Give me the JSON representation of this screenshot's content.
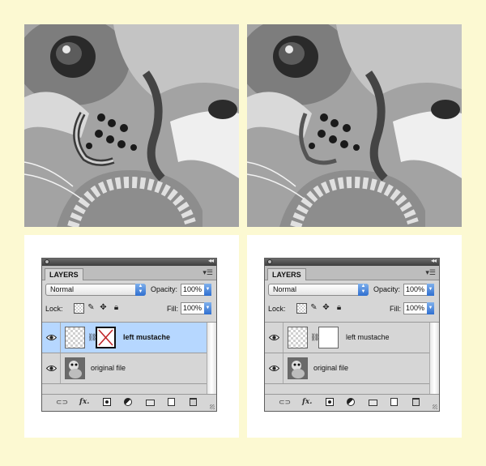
{
  "panels": [
    {
      "id": "left",
      "tab_label": "LAYERS",
      "blend_mode": "Normal",
      "opacity_label": "Opacity:",
      "opacity_value": "100%",
      "lock_label": "Lock:",
      "fill_label": "Fill:",
      "fill_value": "100%",
      "layers": [
        {
          "name": "left mustache",
          "selected": true,
          "mask_state": "selected-crossed"
        },
        {
          "name": "original file",
          "selected": false
        }
      ]
    },
    {
      "id": "right",
      "tab_label": "LAYERS",
      "blend_mode": "Normal",
      "opacity_label": "Opacity:",
      "opacity_value": "100%",
      "lock_label": "Lock:",
      "fill_label": "Fill:",
      "fill_value": "100%",
      "layers": [
        {
          "name": "left mustache",
          "selected": false,
          "mask_state": "white"
        },
        {
          "name": "original file",
          "selected": false
        }
      ]
    }
  ],
  "bottom_icons": [
    "link-icon",
    "fx-icon",
    "mask-icon",
    "adjustment-icon",
    "folder-icon",
    "new-layer-icon",
    "trash-icon"
  ],
  "colors": {
    "background": "#fcf9d2",
    "selection": "#b6d7ff",
    "mask_cross": "#c0282b"
  }
}
